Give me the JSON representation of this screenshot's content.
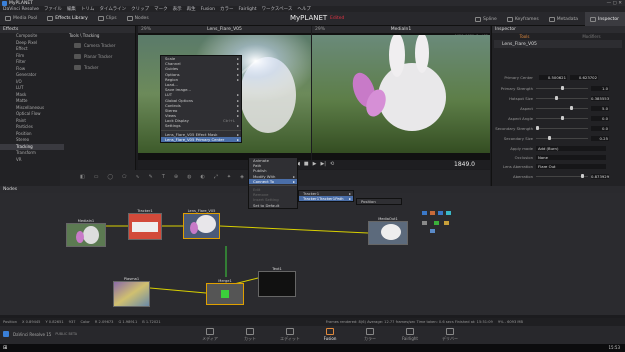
{
  "app": {
    "title": "MyPLANET",
    "appname_short": "DaVinci Resolve",
    "project_name": "MyPLANET",
    "edited_label": "Edited",
    "menu": [
      "DaVinci Resolve",
      "ファイル",
      "編集",
      "トリム",
      "タイムライン",
      "クリップ",
      "マーク",
      "表示",
      "再生",
      "Fusion",
      "カラー",
      "Fairlight",
      "ワークスペース",
      "ヘルプ"
    ]
  },
  "toolbar": {
    "media_pool": "Media Pool",
    "effects_library": "Effects Library",
    "clips": "Clips",
    "nodes": "Nodes",
    "spline": "Spline",
    "keyframes": "Keyframes",
    "metadata": "Metadata",
    "inspector": "Inspector"
  },
  "effects": {
    "header": "Effects",
    "categories": [
      "Composite",
      "Deep Pixel",
      "Effect",
      "Film",
      "Filter",
      "Flow",
      "Generator",
      "I/O",
      "LUT",
      "Mask",
      "Matte",
      "Miscellaneous",
      "Optical Flow",
      "Paint",
      "Particles",
      "Position",
      "Stereo",
      "Tracking",
      "Transform",
      "VR"
    ],
    "selected": "Tracking",
    "tools_header": "Tools \\ Tracking",
    "tools": [
      "Camera Tracker",
      "Planar Tracker",
      "Tracker"
    ]
  },
  "viewer_left": {
    "zoom": "29%",
    "title": "Lens_Flare_V05",
    "fit": "Fit",
    "zoom_value": "56%"
  },
  "viewer_right": {
    "zoom": "29%",
    "title": "MediaIn1",
    "resolution": "1920x1080xfloat32"
  },
  "transport": {
    "frame": "1849.0"
  },
  "context_menu": {
    "items": [
      "Scale",
      "Channel",
      "Guides",
      "Options",
      "Region",
      "Load...",
      "Save Image...",
      "LUT",
      "Global Options",
      "Controls",
      "Stereo",
      "Views",
      "Lock Display",
      "Settings"
    ],
    "lock_shortcut": "Ctrl+L",
    "footer1": "Lens_Flare_V05 Effect Mask",
    "footer2": "Lens_Flare_V05 Primary Center"
  },
  "sub_menu": {
    "items": [
      "Animate",
      "Path",
      "Publish",
      "Modify With",
      "Connect To",
      "Edit",
      "Remove",
      "Insert Setting",
      "Set to Default"
    ],
    "highlighted": "Connect To"
  },
  "sub_menu2": {
    "items": [
      "Tracker1",
      "Tracker1Tracker1Path"
    ],
    "highlighted": "Tracker1Tracker1Path"
  },
  "sub_menu3": {
    "items": [
      "Position"
    ]
  },
  "inspector": {
    "tabs": [
      "Tools",
      "Modifiers"
    ],
    "tool_name": "Lens_Flare_V05",
    "rows": [
      {
        "label": "Primary Center",
        "x": "0.500621",
        "y": "0.623702"
      },
      {
        "label": "Primary Strength",
        "value": "1.0",
        "level": 0.5
      },
      {
        "label": "Hotspot Size",
        "value": "0.385553",
        "level": 0.38
      },
      {
        "label": "Aspect",
        "value": "5.0",
        "level": 0.7
      },
      {
        "label": "Aspect Angle",
        "value": "0.0",
        "level": 0.5
      },
      {
        "label": "Secondary Strength",
        "value": "0.0",
        "level": 0.0
      },
      {
        "label": "Secondary Size",
        "value": "0.25",
        "level": 0.25
      }
    ],
    "apply_mode_label": "Apply mode",
    "apply_mode": "Add (Burn)",
    "occlusion_label": "Occlusion",
    "occlusion": "None",
    "lens_aberration_label": "Lens Aberration",
    "lens_aberration": "Flare Out",
    "aberration_label": "Aberration",
    "aberration": "0.873929"
  },
  "nodes": {
    "header": "Nodes",
    "items": [
      "MediaIn1",
      "Tracker1",
      "Lens_Flare_V05",
      "MediaOut1",
      "Plasma1",
      "Merge1",
      "Text1"
    ]
  },
  "status": {
    "position": "Position",
    "x": "X 0.89445",
    "y": "Y 0.82651",
    "z": "937",
    "color": "Color",
    "r": "R 2.09673",
    "g": "G 1.98911",
    "b": "B 1.72021",
    "render": "Frames rendered: 8(6) Average: 12.77 frames/sec  Time taken: 0.6 secs  Finished at: 15:51:09",
    "memory": "9% - 6093 MB"
  },
  "pages": [
    "メディア",
    "カット",
    "エディット",
    "Fusion",
    "カラー",
    "Fairlight",
    "デリバー"
  ],
  "active_page": "Fusion",
  "taskbar": {
    "app": "DaVinci Resolve 15",
    "beta": "PUBLIC BETA",
    "time": "15:53"
  },
  "colors": {
    "accent": "#e08a3e",
    "selected_node": "#e0a000",
    "menu_highlight": "#4a6ea8",
    "edited": "#dd3344"
  }
}
